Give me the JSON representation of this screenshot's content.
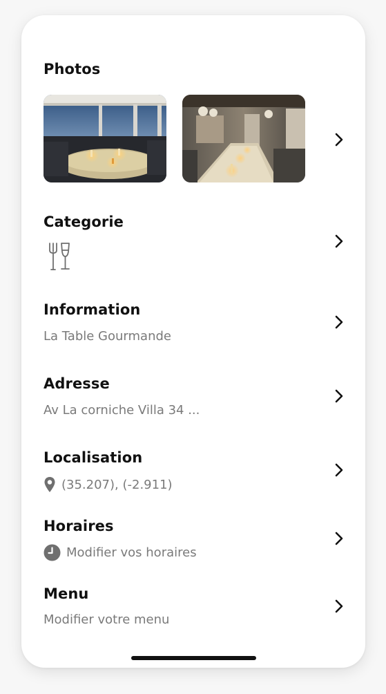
{
  "sections": {
    "photos": {
      "title": "Photos"
    },
    "categorie": {
      "title": "Categorie",
      "icon": "restaurant-drinks-icon"
    },
    "information": {
      "title": "Information",
      "value": "La Table Gourmande"
    },
    "adresse": {
      "title": "Adresse",
      "value": "Av La corniche Villa 34 ..."
    },
    "localisation": {
      "title": "Localisation",
      "value": "(35.207), (-2.911)",
      "icon": "location-pin-icon"
    },
    "horaires": {
      "title": "Horaires",
      "value": "Modifier vos horaires",
      "icon": "clock-icon"
    },
    "menu": {
      "title": "Menu",
      "value": "Modifier votre menu"
    }
  },
  "colors": {
    "title": "#111111",
    "subtitle": "#7a7a7a",
    "icon_gray": "#6f6f6f"
  }
}
